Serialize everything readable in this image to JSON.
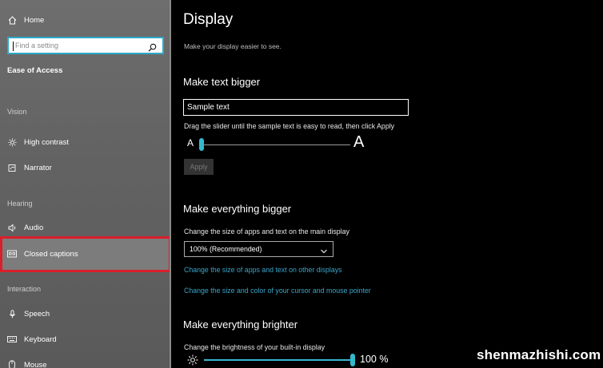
{
  "sidebar": {
    "home_label": "Home",
    "search": {
      "placeholder": "Find a setting"
    },
    "section_title": "Ease of Access",
    "groups": {
      "vision": "Vision",
      "hearing": "Hearing",
      "interaction": "Interaction"
    },
    "items": {
      "high_contrast": "High contrast",
      "narrator": "Narrator",
      "audio": "Audio",
      "closed_captions": "Closed captions",
      "speech": "Speech",
      "keyboard": "Keyboard",
      "mouse": "Mouse"
    },
    "selected_item": "Closed captions",
    "highlight_color": "#d81f2a"
  },
  "main": {
    "title": "Display",
    "subtitle": "Make your display easier to see.",
    "text_bigger": {
      "heading": "Make text bigger",
      "sample_value": "Sample text",
      "instruction": "Drag the slider until the sample text is easy to read, then click Apply",
      "small_a": "A",
      "big_a": "A",
      "slider_percent": 0,
      "apply_label": "Apply"
    },
    "everything_bigger": {
      "heading": "Make everything bigger",
      "description": "Change the size of apps and text on the main display",
      "dropdown_value": "100% (Recommended)",
      "link_other_displays": "Change the size of apps and text on other displays",
      "link_cursor": "Change the size and color of your cursor and mouse pointer"
    },
    "everything_brighter": {
      "heading": "Make everything brighter",
      "description": "Change the brightness of your built-in display",
      "brightness_value": "100 %"
    },
    "accent_color": "#35b8cf"
  },
  "watermark": "shenmazhishi.com"
}
